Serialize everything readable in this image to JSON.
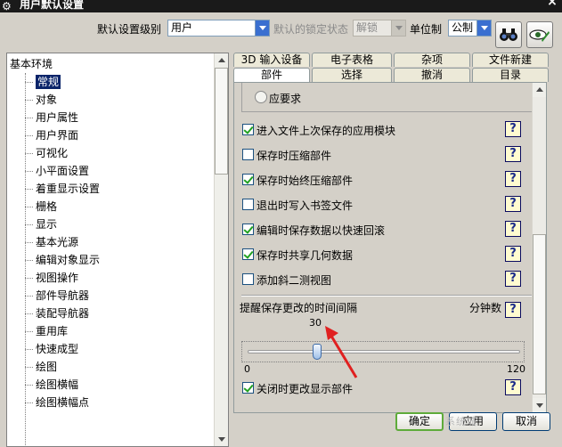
{
  "window": {
    "title": "用户默认设置",
    "close_glyph": "×"
  },
  "toolbar": {
    "level_label": "默认设置级别",
    "level_value": "用户",
    "lock_label": "默认的锁定状态",
    "lock_value": "解锁",
    "unit_label": "单位制",
    "unit_value": "公制"
  },
  "tree": {
    "root": "基本环境",
    "items": [
      "常规",
      "对象",
      "用户属性",
      "用户界面",
      "可视化",
      "小平面设置",
      "着重显示设置",
      "栅格",
      "显示",
      "基本光源",
      "编辑对象显示",
      "视图操作",
      "部件导航器",
      "装配导航器",
      "重用库",
      "快速成型",
      "绘图",
      "绘图横幅",
      "绘图横幅点"
    ],
    "selected_index": 0
  },
  "tabs": {
    "row1": [
      "3D 输入设备",
      "电子表格",
      "杂项",
      "文件新建"
    ],
    "row2": [
      "部件",
      "选择",
      "撤消",
      "目录"
    ],
    "active": "部件"
  },
  "panel": {
    "radio_label": "应要求",
    "options": [
      {
        "label": "进入文件上次保存的应用模块",
        "checked": true
      },
      {
        "label": "保存时压缩部件",
        "checked": false
      },
      {
        "label": "保存时始终压缩部件",
        "checked": true
      },
      {
        "label": "退出时写入书签文件",
        "checked": false
      },
      {
        "label": "编辑时保存数据以快速回滚",
        "checked": true
      },
      {
        "label": "保存时共享几何数据",
        "checked": true
      },
      {
        "label": "添加斜二测视图",
        "checked": false
      }
    ],
    "interval_label": "提醒保存更改的时间间隔",
    "unit_label": "分钟数",
    "slider_value": "30",
    "slider_min": "0",
    "slider_max": "120",
    "close_option": {
      "label": "关闭时更改显示部件",
      "checked": true
    },
    "help_glyph": "?"
  },
  "buttons": {
    "ok": "确定",
    "apply": "应用",
    "cancel": "取消"
  },
  "watermark": "系统城"
}
